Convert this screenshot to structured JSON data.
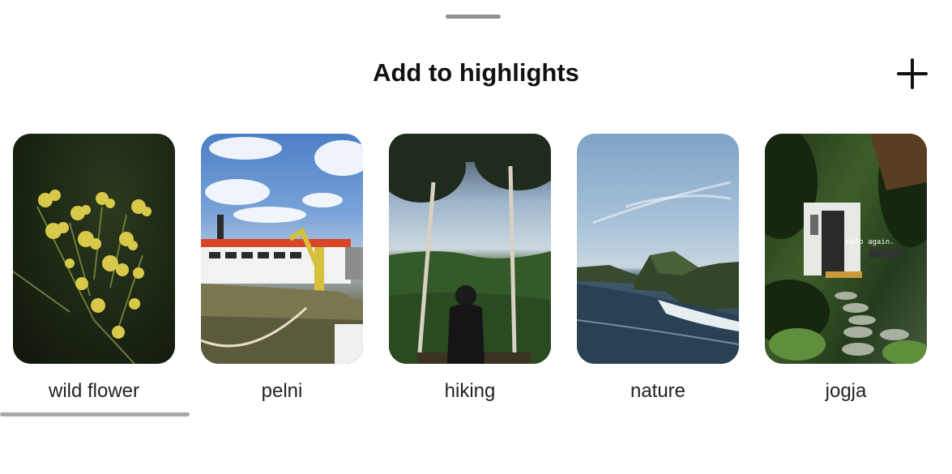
{
  "sheet": {
    "title": "Add to highlights"
  },
  "highlights": [
    {
      "label": "wild flower"
    },
    {
      "label": "pelni"
    },
    {
      "label": "hiking"
    },
    {
      "label": "nature"
    },
    {
      "label": "jogja"
    }
  ],
  "photo_text": {
    "jogja_caption": "Halo again."
  }
}
